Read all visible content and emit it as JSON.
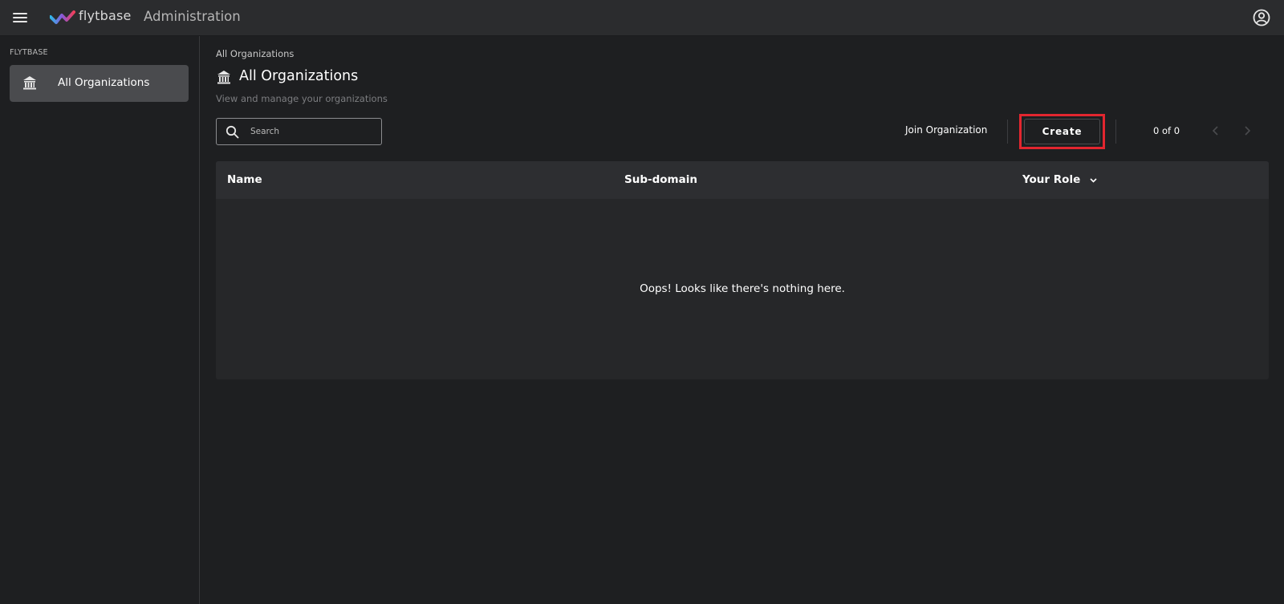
{
  "header": {
    "brand": "flytbase",
    "app_title": "Administration",
    "icons": {
      "menu": "hamburger-menu-icon",
      "logo": "flytbase-logo-icon",
      "profile": "user-circle-icon"
    }
  },
  "sidebar": {
    "section_label": "FLYTBASE",
    "items": [
      {
        "label": "All Organizations",
        "icon": "institution-icon",
        "active": true
      }
    ]
  },
  "main": {
    "breadcrumb": "All Organizations",
    "title": "All Organizations",
    "subtitle": "View and manage your organizations",
    "search": {
      "placeholder": "Search",
      "value": ""
    },
    "actions": {
      "join_label": "Join Organization",
      "create_label": "Create"
    },
    "pagination": {
      "text": "0 of 0"
    },
    "table": {
      "columns": [
        "Name",
        "Sub-domain",
        "Your Role"
      ],
      "empty_message": "Oops! Looks like there's nothing here.",
      "rows": []
    }
  },
  "colors": {
    "background": "#1e1f21",
    "topbar": "#2b2c2e",
    "sidebar_active": "#4a4b4e",
    "highlight": "#e3262f"
  }
}
